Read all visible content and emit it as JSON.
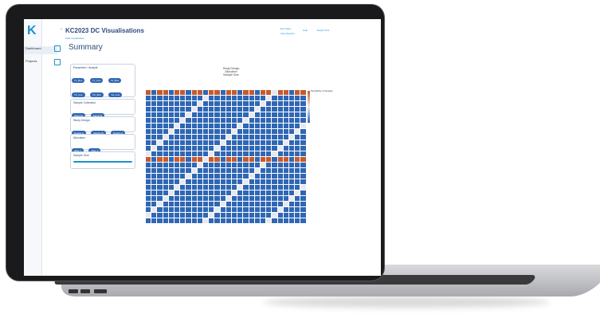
{
  "app": {
    "logo_text": "K",
    "header_title": "KC2023 DC Visualisations",
    "header_sub": "Data Visualisation",
    "page_title": "Summary"
  },
  "nav": [
    {
      "label": "Dashboard",
      "icon": "dashboard-icon"
    },
    {
      "label": "Projects",
      "icon": "folder-icon"
    }
  ],
  "top_right": {
    "links": [
      "Run Data",
      "View Reports",
      "Help",
      "Report Tool"
    ]
  },
  "filters": [
    {
      "title": "Parameter / Analyte",
      "chips": [
        "T1_Bos",
        "T1_Cos",
        "T2_Bos",
        "T2_Cos",
        "Tot_Bos",
        "Tot_Cos",
        "Creatin"
      ]
    },
    {
      "title": "Sample Collection",
      "chips": [
        "Sampl A",
        "Sampl B"
      ]
    },
    {
      "title": "Study Design",
      "chips": [
        "Design A",
        "Design B",
        "Design C"
      ]
    },
    {
      "title": "Allocation",
      "chips": [
        "Alloc 1",
        "Alloc 2"
      ]
    },
    {
      "title": "Sample Size",
      "chips": []
    }
  ],
  "chart": {
    "title_lines": [
      "Study Design",
      "Allocation",
      "Sample Size"
    ],
    "legend_label": "Sensitivity of Analyte",
    "colors": {
      "high": "#c65a2e",
      "mid": "#e8e8ee",
      "low": "#2f67b4"
    }
  },
  "chart_data": {
    "type": "heatmap",
    "rows": 24,
    "cols": 28
  }
}
